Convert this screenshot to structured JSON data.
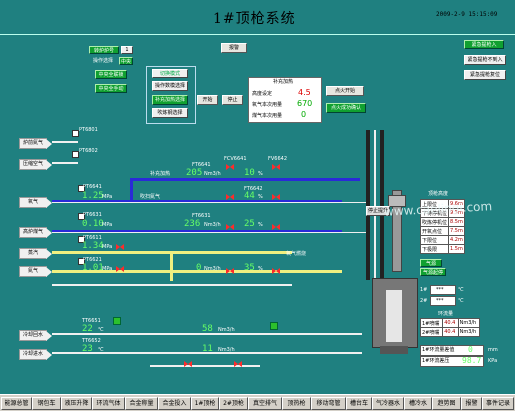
{
  "title": "1#顶枪系统",
  "datetime": "2009-2-9 15:15:09",
  "watermark": "www.caelingi.com",
  "header": {
    "alarm_btn": "报警",
    "status_label": "转炉炉号",
    "status_value": "1",
    "op_mode": "操作选择",
    "op_mode_value": "中央",
    "center_auto": "中央全联锁",
    "center_manual": "中央全手动"
  },
  "right_buttons": [
    "紧急提枪入",
    "紧急提枪不到入",
    "紧急提枪复位"
  ],
  "mode_panel": {
    "switch_btn": "切换模式",
    "mode1": "操作数模选择",
    "mode2": "补充加热选择",
    "mode3": "吹炼钢选择",
    "open": "开始",
    "stop": "停止"
  },
  "supp_heat": {
    "title": "补充加热",
    "rows": [
      {
        "label": "高度设定",
        "value": "4.5"
      },
      {
        "label": "氧气本次用量",
        "value": "670"
      },
      {
        "label": "煤气本次用量",
        "value": "0"
      }
    ],
    "ignite": "点火开始",
    "ignite_ok": "点火成功确认"
  },
  "left_labels": [
    "炉前氮气",
    "压缩空气",
    "氧气",
    "高炉煤气",
    "蒸汽",
    "氮气",
    "冷却回水",
    "冷却进水"
  ],
  "instruments": {
    "PT6801": "PT6801",
    "PT6802": "PT6802",
    "FT6641": "FT6641",
    "FCV6641": "FCV6641",
    "FV6642": "FV6642",
    "FT6641_val": "205",
    "FT6641_unit": "Nm3/h",
    "FCV6641_val": "10",
    "FCV6641_unit": "%",
    "PT6641": "PT6641",
    "PT6641_val": "1.25",
    "PT6641_unit": "MPa",
    "FT6642": "FT6642",
    "FT6642_val": "44",
    "FT6642_unit": "%",
    "PT6631": "PT6631",
    "PT6631_val": "0.10",
    "PT6631_unit": "MPa",
    "FT6631": "FT6631",
    "FT6631_val": "236",
    "FT6631_unit": "Nm3/h",
    "FCV6631_val": "25",
    "FCV6631_unit": "%",
    "PT6611": "PT6611",
    "PT6611_val": "1.34",
    "PT6611_unit": "MPa",
    "PT6621": "PT6621",
    "PT6621_val": "1.01",
    "PT6621_unit": "MPa",
    "FT6622_val": "0",
    "FT6622_unit": "Nm3/h",
    "FCV6622_val": "35",
    "FCV6622_unit": "%",
    "TT6651": "TT6651",
    "TT6651_val": "22",
    "TT6651_unit": "℃",
    "FT6651_val": "58",
    "FT6651_unit": "Nm3/h",
    "TT6652": "TT6652",
    "TT6652_val": "23",
    "TT6652_unit": "℃",
    "FT6652_val": "11",
    "FT6652_unit": "Nm3/h",
    "heat_gas": "补充加热",
    "purge": "吹扫氮气",
    "oxygen_comb": "氧气燃烧"
  },
  "lance_table": {
    "title": "顶枪高度",
    "rows": [
      [
        "上限位",
        "9.6m"
      ],
      [
        "下待停机位",
        "9.5m"
      ],
      [
        "吹炼停机位",
        "8.5m"
      ],
      [
        "开氧点位",
        "7.5m"
      ],
      [
        "下限位",
        "4.2m"
      ],
      [
        "下极限",
        "1.5m"
      ]
    ]
  },
  "lance_tags": {
    "stop_ok": "停止提升",
    "gas_label": "气源",
    "gas_val": "气源起停"
  },
  "right_readouts": [
    {
      "label": "1#",
      "value": "***",
      "unit": "℃"
    },
    {
      "label": "2#",
      "value": "***",
      "unit": "℃"
    }
  ],
  "flow_table": {
    "title": "环流量",
    "rows": [
      [
        "1#喷嘴",
        "40.4",
        "Nm3/h"
      ],
      [
        "2#喷嘴",
        "40.4",
        "Nm3/h"
      ]
    ]
  },
  "bottom_readouts": [
    {
      "label": "1#环流量差值",
      "value": "0",
      "unit": "mm"
    },
    {
      "label": "1#环流差压",
      "value": "98.7",
      "unit": "KPa"
    }
  ],
  "taskbar": [
    "能源总管",
    "钢包车",
    "液压升降",
    "环流气体",
    "合金称量",
    "合金投入",
    "1#顶枪",
    "2#顶枪",
    "真空排气",
    "顶热枪",
    "移动弯管",
    "槽台车",
    "气冷器水",
    "槽冷水",
    "趋势图",
    "报警",
    "事件记录"
  ]
}
